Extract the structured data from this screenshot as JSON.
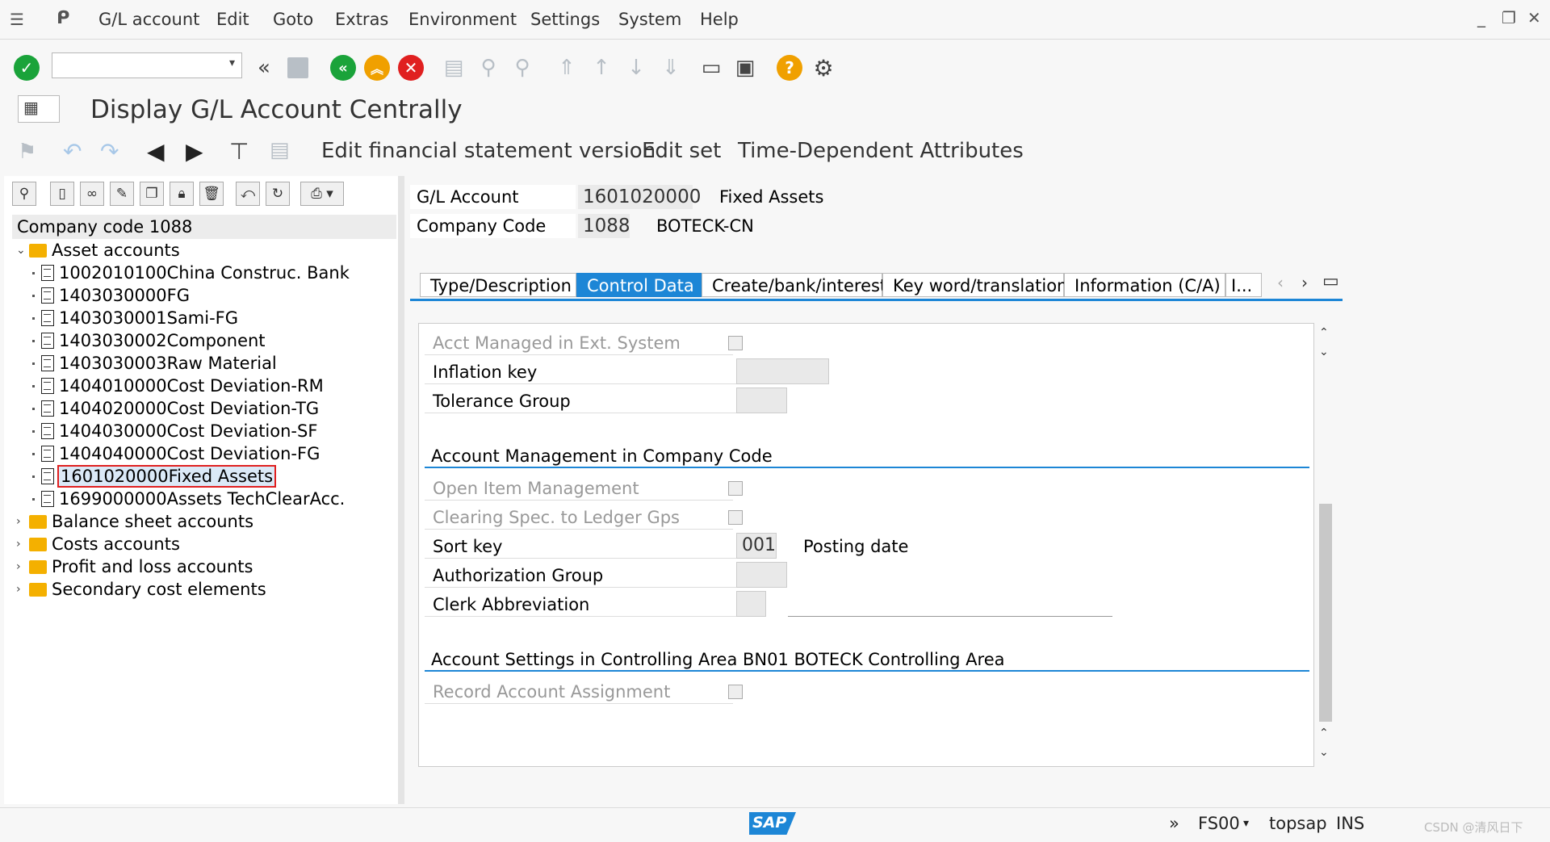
{
  "menubar": {
    "items": [
      "G/L account",
      "Edit",
      "Goto",
      "Extras",
      "Environment",
      "Settings",
      "System",
      "Help"
    ]
  },
  "window_controls": {
    "minimize": "_",
    "restore": "❐",
    "close": "✕"
  },
  "toolbar": {
    "command_field_value": "",
    "icons": [
      "enter-icon",
      "back-nav-icon",
      "save-icon",
      "back-icon",
      "exit-icon",
      "cancel-icon",
      "print-icon",
      "find-icon",
      "find-next-icon",
      "first-page-icon",
      "previous-page-icon",
      "next-page-icon",
      "last-page-icon",
      "new-session-icon",
      "shortcut-icon",
      "help-icon",
      "customize-layout-icon"
    ]
  },
  "page": {
    "title": "Display G/L Account Centrally"
  },
  "app_toolbar": {
    "buttons": [
      "Edit financial statement version",
      "Edit set",
      "Time-Dependent Attributes"
    ]
  },
  "tree": {
    "header": "Company code 1088",
    "root": {
      "label": "Asset accounts",
      "children": [
        "1002010100China Construc. Bank",
        "1403030000FG",
        "1403030001Sami-FG",
        "1403030002Component",
        "1403030003Raw Material",
        "1404010000Cost Deviation-RM",
        "1404020000Cost Deviation-TG",
        "1404030000Cost Deviation-SF",
        "1404040000Cost Deviation-FG",
        "1601020000Fixed Assets",
        "1699000000Assets TechClearAcc."
      ],
      "selected": "1601020000Fixed Assets"
    },
    "folders": [
      "Balance sheet accounts",
      "Costs accounts",
      "Profit and loss accounts",
      "Secondary cost elements"
    ]
  },
  "header": {
    "gl_account_label": "G/L Account",
    "gl_account_value": "1601020000",
    "gl_account_desc": "Fixed Assets",
    "company_code_label": "Company Code",
    "company_code_value": "1088",
    "company_code_desc": "BOTECK-CN"
  },
  "tabs": [
    "Type/Description",
    "Control Data",
    "Create/bank/interest",
    "Key word/translation",
    "Information (C/A)",
    "I..."
  ],
  "active_tab": "Control Data",
  "control_data": {
    "acct_managed_ext": "Acct Managed in Ext. System",
    "inflation_key": "Inflation key",
    "tolerance_group": "Tolerance Group",
    "section_account_mgmt": "Account Management in Company Code",
    "open_item_mgmt": "Open Item Management",
    "clearing_spec": "Clearing Spec. to Ledger Gps",
    "sort_key_label": "Sort key",
    "sort_key_value": "001",
    "sort_key_desc": "Posting date",
    "authorization_group": "Authorization Group",
    "clerk_abbreviation": "Clerk Abbreviation",
    "section_controlling": "Account Settings in Controlling Area BN01 BOTECK Controlling Area",
    "record_account_assignment": "Record Account Assignment"
  },
  "statusbar": {
    "sap_logo": "SAP",
    "expand": "»",
    "transaction": "FS00",
    "server": "topsap",
    "mode": "INS",
    "watermark": "CSDN @清风日下"
  },
  "colors": {
    "accent": "#1d86d6",
    "enter_green": "#1aa33a",
    "back_green": "#1aa33a",
    "exit_orange": "#f0a000",
    "cancel_red": "#e02020",
    "help_orange": "#f0a000",
    "folder": "#f4b000"
  }
}
